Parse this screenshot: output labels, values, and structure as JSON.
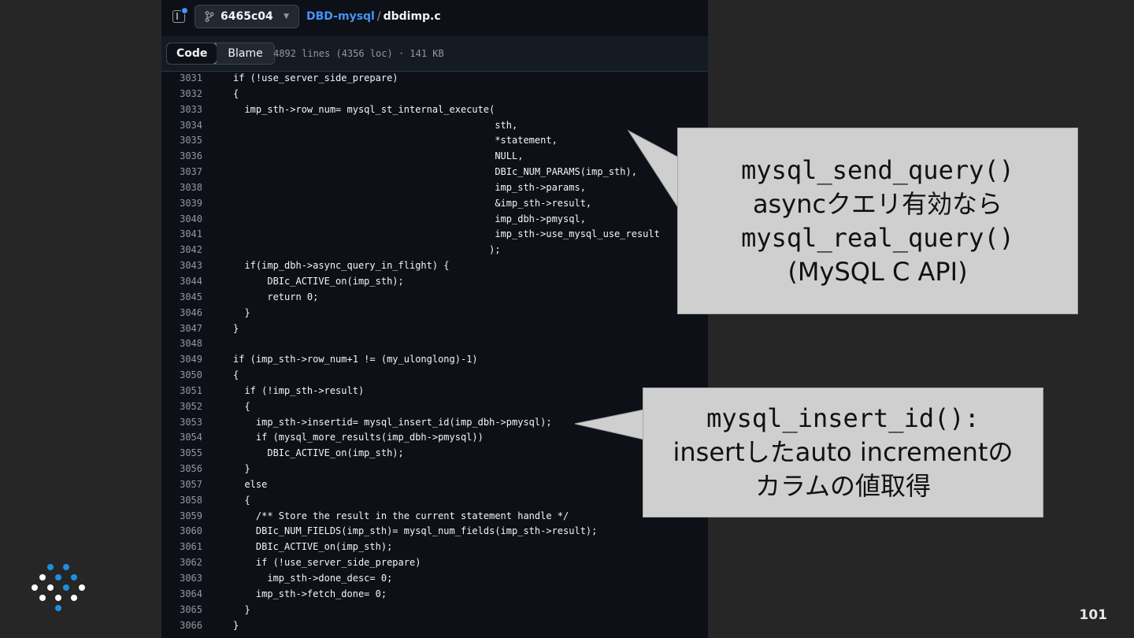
{
  "header": {
    "branch": "6465c04",
    "repo": "DBD-mysql",
    "separator": "/",
    "file": "dbdimp.c"
  },
  "file_bar": {
    "tabs": [
      {
        "label": "Code"
      },
      {
        "label": "Blame"
      }
    ],
    "stats": "4892 lines (4356 loc) · 141 KB"
  },
  "code_lines": [
    {
      "ln": "3031",
      "code": "if (!use_server_side_prepare)"
    },
    {
      "ln": "3032",
      "code": "{"
    },
    {
      "ln": "3033",
      "code": "  imp_sth->row_num= mysql_st_internal_execute("
    },
    {
      "ln": "3034",
      "code": "                                              sth,"
    },
    {
      "ln": "3035",
      "code": "                                              *statement,"
    },
    {
      "ln": "3036",
      "code": "                                              NULL,"
    },
    {
      "ln": "3037",
      "code": "                                              DBIc_NUM_PARAMS(imp_sth),"
    },
    {
      "ln": "3038",
      "code": "                                              imp_sth->params,"
    },
    {
      "ln": "3039",
      "code": "                                              &imp_sth->result,"
    },
    {
      "ln": "3040",
      "code": "                                              imp_dbh->pmysql,"
    },
    {
      "ln": "3041",
      "code": "                                              imp_sth->use_mysql_use_result"
    },
    {
      "ln": "3042",
      "code": "                                             );"
    },
    {
      "ln": "3043",
      "code": "  if(imp_dbh->async_query_in_flight) {"
    },
    {
      "ln": "3044",
      "code": "      DBIc_ACTIVE_on(imp_sth);"
    },
    {
      "ln": "3045",
      "code": "      return 0;"
    },
    {
      "ln": "3046",
      "code": "  }"
    },
    {
      "ln": "3047",
      "code": "}"
    },
    {
      "ln": "3048",
      "code": ""
    },
    {
      "ln": "3049",
      "code": "if (imp_sth->row_num+1 != (my_ulonglong)-1)"
    },
    {
      "ln": "3050",
      "code": "{"
    },
    {
      "ln": "3051",
      "code": "  if (!imp_sth->result)"
    },
    {
      "ln": "3052",
      "code": "  {"
    },
    {
      "ln": "3053",
      "code": "    imp_sth->insertid= mysql_insert_id(imp_dbh->pmysql);"
    },
    {
      "ln": "3054",
      "code": "    if (mysql_more_results(imp_dbh->pmysql))"
    },
    {
      "ln": "3055",
      "code": "      DBIc_ACTIVE_on(imp_sth);"
    },
    {
      "ln": "3056",
      "code": "  }"
    },
    {
      "ln": "3057",
      "code": "  else"
    },
    {
      "ln": "3058",
      "code": "  {"
    },
    {
      "ln": "3059",
      "code": "    /** Store the result in the current statement handle */"
    },
    {
      "ln": "3060",
      "code": "    DBIc_NUM_FIELDS(imp_sth)= mysql_num_fields(imp_sth->result);"
    },
    {
      "ln": "3061",
      "code": "    DBIc_ACTIVE_on(imp_sth);"
    },
    {
      "ln": "3062",
      "code": "    if (!use_server_side_prepare)"
    },
    {
      "ln": "3063",
      "code": "      imp_sth->done_desc= 0;"
    },
    {
      "ln": "3064",
      "code": "    imp_sth->fetch_done= 0;"
    },
    {
      "ln": "3065",
      "code": "  }"
    },
    {
      "ln": "3066",
      "code": "}"
    }
  ],
  "callouts": [
    {
      "lines": [
        {
          "text": "mysql_send_query()",
          "mono": true
        },
        {
          "text": "asyncクエリ有効なら",
          "mono": false
        },
        {
          "text": "mysql_real_query()",
          "mono": true
        },
        {
          "text": "(MySQL C API)",
          "mono": false
        }
      ]
    },
    {
      "lines": [
        {
          "text": "mysql_insert_id():",
          "mono": true
        },
        {
          "text": "insertしたauto incrementの",
          "mono": false
        },
        {
          "text": "カラムの値取得",
          "mono": false
        }
      ]
    }
  ],
  "page_number": "101",
  "colors": {
    "slide_background": "#262626",
    "code_background": "#0d1117",
    "link_blue": "#4493f8",
    "callout_fill": "#cfcfcf",
    "logo_blue": "#1e8fe0"
  }
}
